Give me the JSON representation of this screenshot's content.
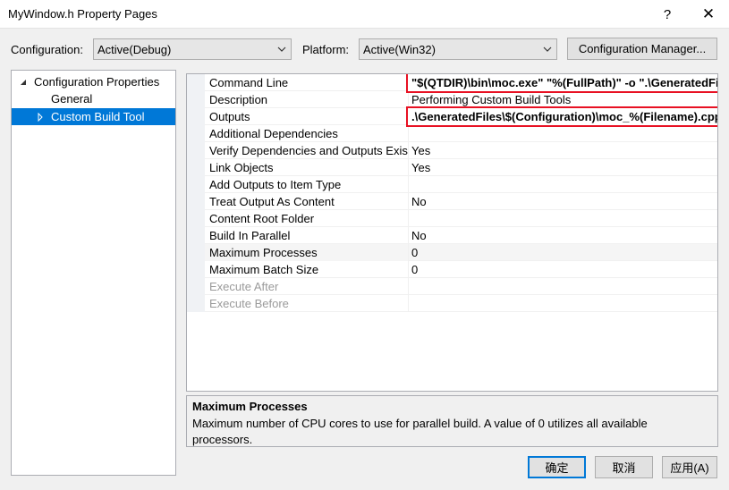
{
  "window": {
    "title": "MyWindow.h Property Pages",
    "help": "?",
    "close": "✕"
  },
  "toolbar": {
    "configuration_label": "Configuration:",
    "configuration_value": "Active(Debug)",
    "platform_label": "Platform:",
    "platform_value": "Active(Win32)",
    "config_manager_label": "Configuration Manager..."
  },
  "tree": {
    "root": "Configuration Properties",
    "items": [
      "General",
      "Custom Build Tool"
    ],
    "selected": "Custom Build Tool"
  },
  "properties": [
    {
      "name": "Command Line",
      "value": "\"$(QTDIR)\\bin\\moc.exe\"  \"%(FullPath)\" -o \".\\GeneratedFiles\\$(Configuration)\\moc_%(Filename).cpp\""
    },
    {
      "name": "Description",
      "value": "Performing Custom Build Tools"
    },
    {
      "name": "Outputs",
      "value": ".\\GeneratedFiles\\$(Configuration)\\moc_%(Filename).cpp"
    },
    {
      "name": "Additional Dependencies",
      "value": ""
    },
    {
      "name": "Verify Dependencies and Outputs Exis",
      "value": "Yes"
    },
    {
      "name": "Link Objects",
      "value": "Yes"
    },
    {
      "name": "Add Outputs to Item Type",
      "value": ""
    },
    {
      "name": "Treat Output As Content",
      "value": "No"
    },
    {
      "name": "Content Root Folder",
      "value": ""
    },
    {
      "name": "Build In Parallel",
      "value": "No"
    },
    {
      "name": "Maximum Processes",
      "value": "0"
    },
    {
      "name": "Maximum Batch Size",
      "value": "0"
    },
    {
      "name": "Execute After",
      "value": ""
    },
    {
      "name": "Execute Before",
      "value": ""
    }
  ],
  "description": {
    "title": "Maximum Processes",
    "text": "Maximum number of CPU cores to use for parallel build. A value of 0 utilizes all available processors."
  },
  "buttons": {
    "ok": "确定",
    "cancel": "取消",
    "apply": "应用(A)"
  },
  "colors": {
    "selection": "#0078d7",
    "highlight_border": "#e81123"
  }
}
